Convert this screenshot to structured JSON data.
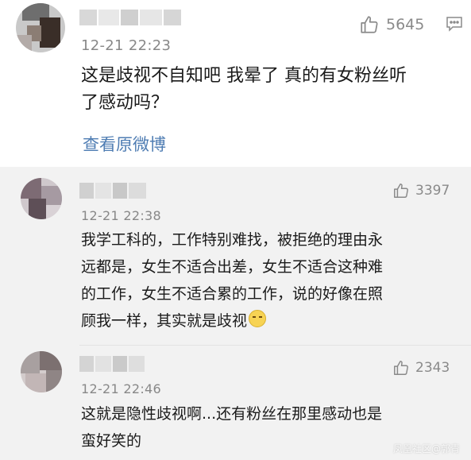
{
  "main_comment": {
    "time": "12-21 22:23",
    "likes": "5645",
    "text_lines": [
      "这是歧视不自知吧 我晕了 真的有女粉丝听",
      "了感动吗？"
    ],
    "view_original": "查看原微博",
    "more_icon": "more-dots-icon"
  },
  "replies": [
    {
      "time": "12-21 22:38",
      "likes": "3397",
      "text_lines": [
        "我学工科的，工作特别难找，被拒绝的理由永",
        "远都是，女生不适合出差，女生不适合这种难",
        "的工作，女生不适合累的工作，说的好像在照",
        "顾我一样，其实就是歧视"
      ],
      "emoji": "sweat-smile-emoji"
    },
    {
      "time": "12-21 22:46",
      "likes": "2343",
      "text_lines": [
        "这就是隐性歧视啊...还有粉丝在那里感动也是",
        "蛮好笑的"
      ]
    }
  ],
  "watermark": "凤凰社区@郭青",
  "colors": {
    "link": "#4f7db3",
    "meta": "#888888",
    "reply_bg": "#f2f2f2"
  }
}
